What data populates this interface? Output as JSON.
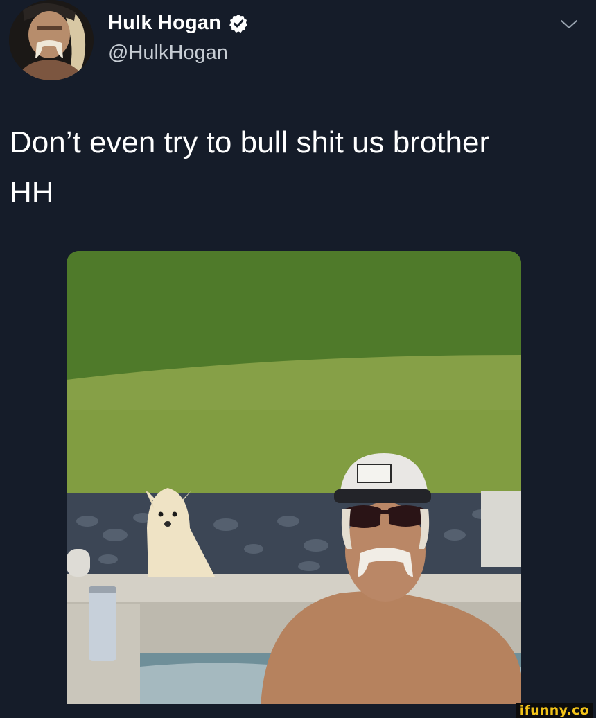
{
  "tweet": {
    "display_name": "Hulk Hogan",
    "handle": "@HulkHogan",
    "verified": true,
    "text": "Don’t even try to bull shit us brother\nHH",
    "media_alt": ""
  },
  "icons": {
    "verified": "verified-badge-icon",
    "menu": "chevron-down-icon"
  },
  "watermark": {
    "text": "ifunny.co"
  },
  "colors": {
    "background": "#151c29",
    "text_primary": "#ffffff",
    "text_secondary": "#c7cdd4",
    "watermark_text": "#f2c318"
  }
}
